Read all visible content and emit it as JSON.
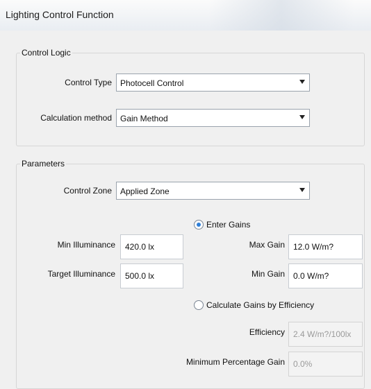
{
  "window": {
    "title": "Lighting Control Function"
  },
  "control_logic": {
    "legend": "Control Logic",
    "control_type": {
      "label": "Control Type",
      "value": "Photocell Control"
    },
    "calculation_method": {
      "label": "Calculation method",
      "value": "Gain Method"
    }
  },
  "parameters": {
    "legend": "Parameters",
    "control_zone": {
      "label": "Control Zone",
      "value": "Applied Zone"
    },
    "min_illuminance": {
      "label": "Min Illuminance",
      "value": "420.0 lx"
    },
    "target_illuminance": {
      "label": "Target Illuminance",
      "value": "500.0 lx"
    },
    "enter_gains": {
      "label": "Enter Gains",
      "selected": true
    },
    "max_gain": {
      "label": "Max Gain",
      "value": "12.0 W/m?"
    },
    "min_gain": {
      "label": "Min Gain",
      "value": "0.0 W/m?"
    },
    "calc_by_efficiency": {
      "label": "Calculate Gains by Efficiency",
      "selected": false
    },
    "efficiency": {
      "label": "Efficiency",
      "value": "2.4 W/m?/100lx"
    },
    "min_percentage_gain": {
      "label": "Minimum Percentage Gain",
      "value": "0.0%"
    }
  },
  "colors": {
    "radio_accent": "#2f7fd8",
    "border": "#9aa3ad"
  }
}
